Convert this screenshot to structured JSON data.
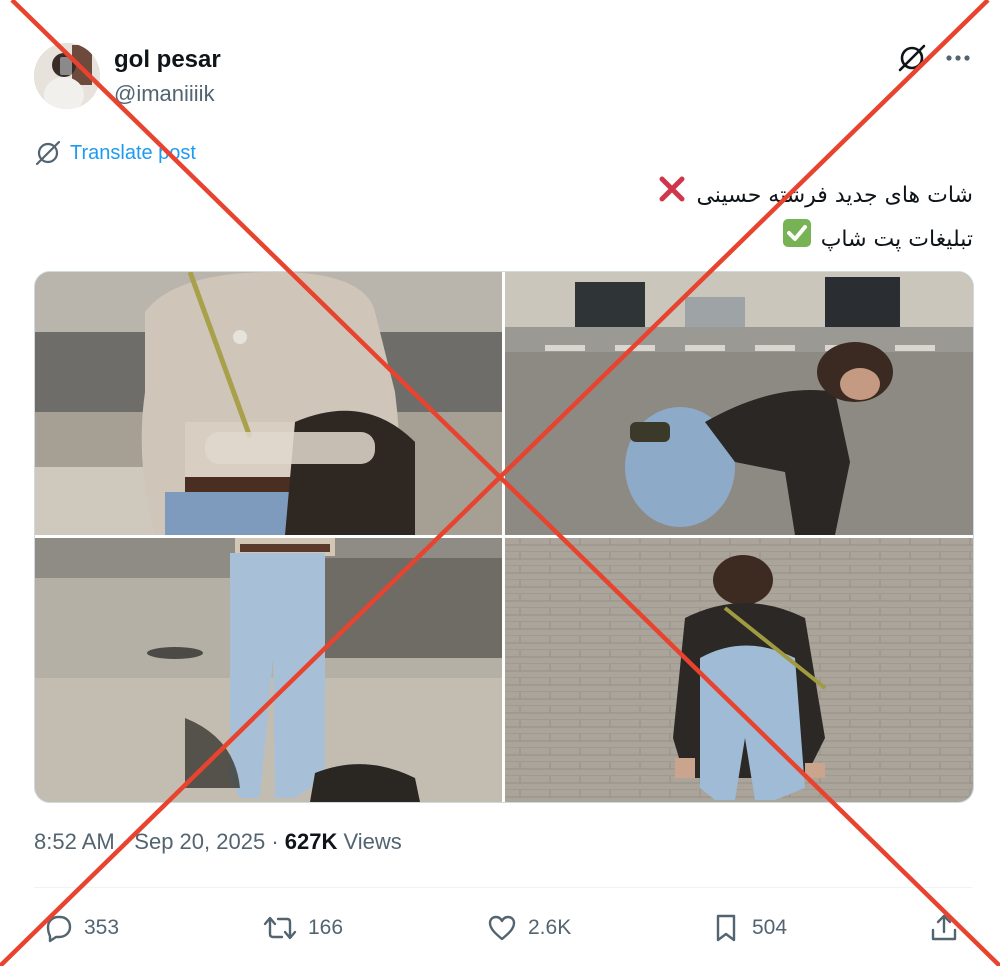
{
  "author": {
    "name": "gol pesar",
    "handle": "@imaniiiik"
  },
  "header_icons": [
    "grok-icon",
    "more-icon"
  ],
  "translate_label": "Translate post",
  "post_text": {
    "line1": "شات های جدید فرشته حسینی",
    "line1_emoji": "cross-mark-emoji",
    "line2": "تبلیغات پت شاپ",
    "line2_emoji": "check-mark-emoji"
  },
  "media": {
    "count": 4,
    "photos": [
      "photo-1",
      "photo-2",
      "photo-3",
      "photo-4"
    ]
  },
  "meta": {
    "time": "8:52 AM",
    "separator": "·",
    "date": "Sep 20, 2025",
    "views_count": "627K",
    "views_label": "Views"
  },
  "actions": {
    "replies": "353",
    "reposts": "166",
    "likes": "2.6K",
    "bookmarks": "504"
  },
  "colors": {
    "accent": "#1d9bf0",
    "text_secondary": "#536471",
    "watermark_red": "#e8432e"
  }
}
